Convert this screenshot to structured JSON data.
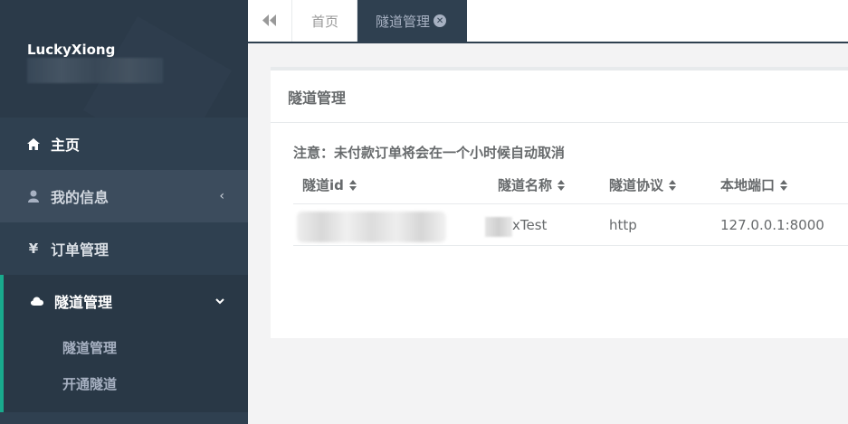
{
  "sidebar": {
    "username": "LuckyXiong",
    "items": [
      {
        "label": "主页",
        "icon": "home-icon"
      },
      {
        "label": "我的信息",
        "icon": "user-icon"
      },
      {
        "label": "订单管理",
        "icon": "yen-icon",
        "icon_glyph": "¥"
      },
      {
        "label": "隧道管理",
        "icon": "cloud-icon"
      }
    ],
    "submenu": [
      "隧道管理",
      "开通隧道"
    ]
  },
  "tabs": {
    "home_label": "首页",
    "active_label": "隧道管理"
  },
  "panel": {
    "title": "隧道管理",
    "notice": "注意：未付款订单将会在一个小时候自动取消",
    "columns": [
      "隧道id",
      "隧道名称",
      "隧道协议",
      "本地端口"
    ],
    "rows": [
      {
        "id": "",
        "name": "xTest",
        "protocol": "http",
        "local_port": "127.0.0.1:8000"
      }
    ]
  },
  "colors": {
    "sidebar_bg": "#2f4050",
    "accent": "#19aa8d",
    "text": "#676a6c"
  }
}
